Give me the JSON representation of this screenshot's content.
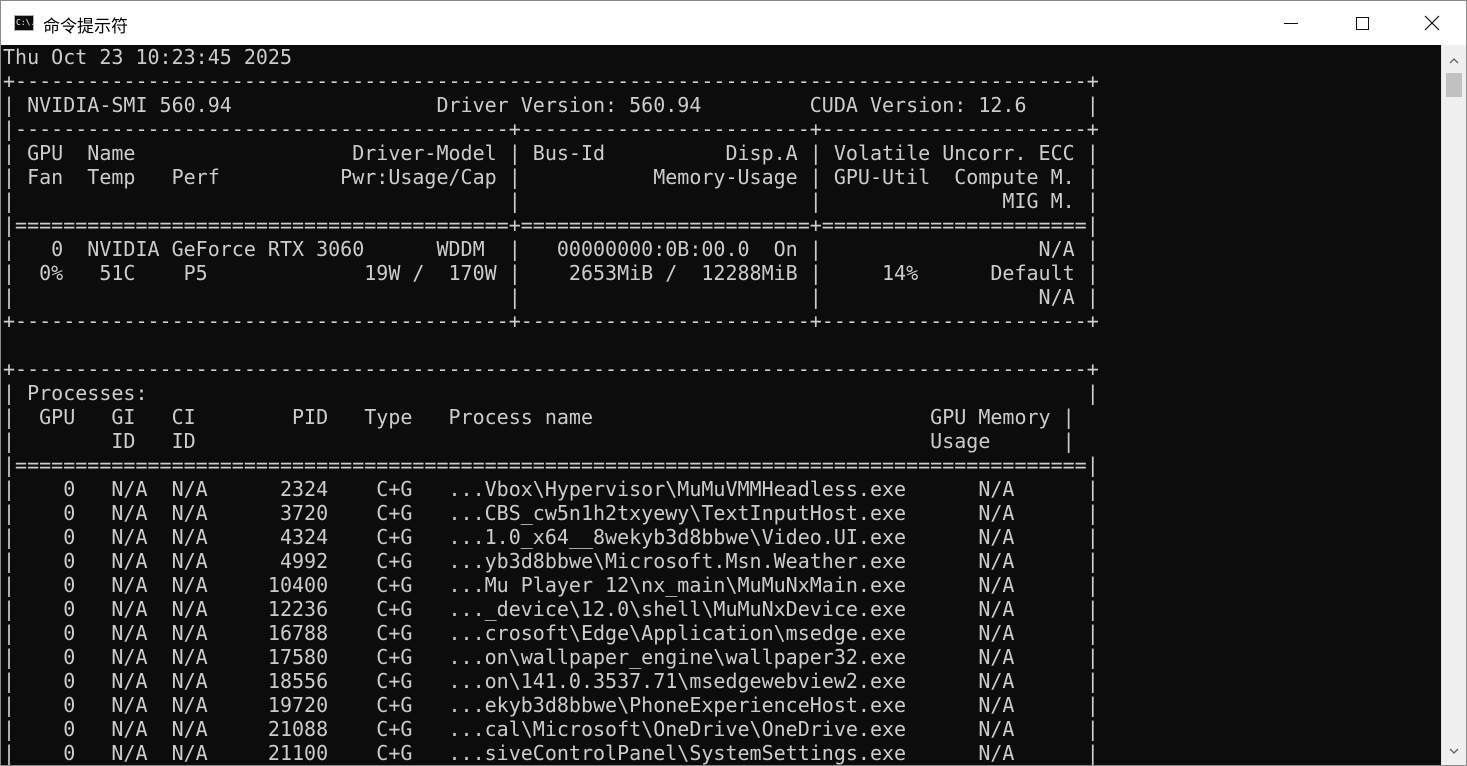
{
  "window": {
    "title": "命令提示符",
    "icon_label": "C:\\.",
    "controls": {
      "minimize_icon": "minimize-icon",
      "maximize_icon": "maximize-icon",
      "close_icon": "close-icon"
    }
  },
  "console": {
    "lines": [
      "Thu Oct 23 10:23:45 2025",
      "+-----------------------------------------------------------------------------------------+",
      "| NVIDIA-SMI 560.94                 Driver Version: 560.94         CUDA Version: 12.6     |",
      "|-----------------------------------------+------------------------+----------------------+",
      "| GPU  Name                  Driver-Model | Bus-Id          Disp.A | Volatile Uncorr. ECC |",
      "| Fan  Temp   Perf          Pwr:Usage/Cap |           Memory-Usage | GPU-Util  Compute M. |",
      "|                                         |                        |               MIG M. |",
      "|=========================================+========================+======================|",
      "|   0  NVIDIA GeForce RTX 3060      WDDM  |   00000000:0B:00.0  On |                  N/A |",
      "|  0%   51C    P5             19W /  170W |    2653MiB /  12288MiB |     14%      Default |",
      "|                                         |                        |                  N/A |",
      "+-----------------------------------------+------------------------+----------------------+",
      "",
      "+-----------------------------------------------------------------------------------------+",
      "| Processes:                                                                              |",
      "|  GPU   GI   CI        PID   Type   Process name                            GPU Memory |",
      "|        ID   ID                                                             Usage      |",
      "|=========================================================================================|",
      "|    0   N/A  N/A      2324    C+G   ...Vbox\\Hypervisor\\MuMuVMMHeadless.exe      N/A      |",
      "|    0   N/A  N/A      3720    C+G   ...CBS_cw5n1h2txyewy\\TextInputHost.exe      N/A      |",
      "|    0   N/A  N/A      4324    C+G   ...1.0_x64__8wekyb3d8bbwe\\Video.UI.exe      N/A      |",
      "|    0   N/A  N/A      4992    C+G   ...yb3d8bbwe\\Microsoft.Msn.Weather.exe      N/A      |",
      "|    0   N/A  N/A     10400    C+G   ...Mu Player 12\\nx_main\\MuMuNxMain.exe      N/A      |",
      "|    0   N/A  N/A     12236    C+G   ..._device\\12.0\\shell\\MuMuNxDevice.exe      N/A      |",
      "|    0   N/A  N/A     16788    C+G   ...crosoft\\Edge\\Application\\msedge.exe      N/A      |",
      "|    0   N/A  N/A     17580    C+G   ...on\\wallpaper_engine\\wallpaper32.exe      N/A      |",
      "|    0   N/A  N/A     18556    C+G   ...on\\141.0.3537.71\\msedgewebview2.exe      N/A      |",
      "|    0   N/A  N/A     19720    C+G   ...ekyb3d8bbwe\\PhoneExperienceHost.exe      N/A      |",
      "|    0   N/A  N/A     21088    C+G   ...cal\\Microsoft\\OneDrive\\OneDrive.exe      N/A      |",
      "|    0   N/A  N/A     21100    C+G   ...siveControlPanel\\SystemSettings.exe      N/A      |"
    ]
  },
  "scrollbar": {
    "up_icon": "scroll-up-arrow-icon",
    "down_icon": "scroll-down-arrow-icon"
  }
}
